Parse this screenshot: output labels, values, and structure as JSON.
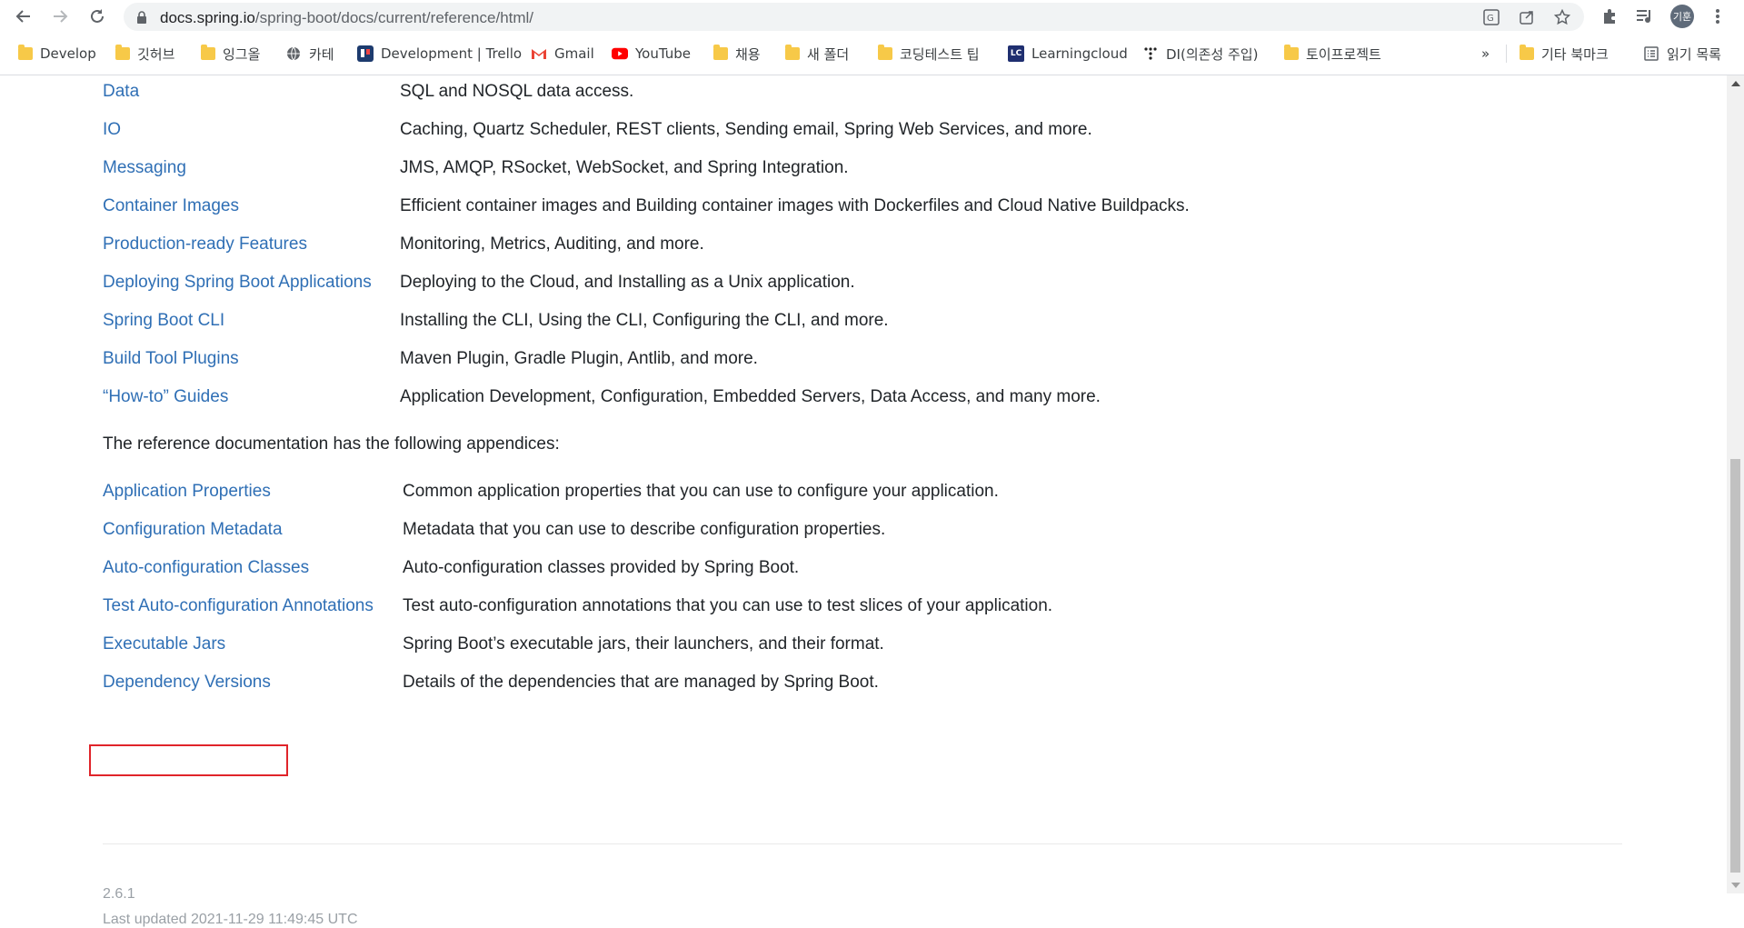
{
  "browser": {
    "url_host": "docs.spring.io",
    "url_path": "/spring-boot/docs/current/reference/html/",
    "avatar_text": "기훈"
  },
  "bookmarks": [
    {
      "label": "Develop",
      "icon": "folder-icon"
    },
    {
      "label": "깃허브",
      "icon": "folder-icon"
    },
    {
      "label": "잉그올",
      "icon": "folder-icon"
    },
    {
      "label": "카테",
      "icon": "globe-icon"
    },
    {
      "label": "Development | Trello",
      "icon": "trello-icon"
    },
    {
      "label": "Gmail",
      "icon": "gmail-icon"
    },
    {
      "label": "YouTube",
      "icon": "youtube-icon"
    },
    {
      "label": "채용",
      "icon": "folder-icon"
    },
    {
      "label": "새 폴더",
      "icon": "folder-icon"
    },
    {
      "label": "코딩테스트 팁",
      "icon": "folder-icon"
    },
    {
      "label": "Learningcloud",
      "icon": "lc-icon"
    },
    {
      "label": "DI(의존성 주입)",
      "icon": "dots-icon"
    },
    {
      "label": "토이프로젝트",
      "icon": "folder-icon"
    }
  ],
  "bookmarks_overflow": "»",
  "other_bookmarks": "기타 북마크",
  "reading_list": "읽기 목록",
  "sections": [
    {
      "link": "Data",
      "desc": "SQL and NOSQL data access."
    },
    {
      "link": "IO",
      "desc": "Caching, Quartz Scheduler, REST clients, Sending email, Spring Web Services, and more."
    },
    {
      "link": "Messaging",
      "desc": "JMS, AMQP, RSocket, WebSocket, and Spring Integration."
    },
    {
      "link": "Container Images",
      "desc": "Efficient container images and Building container images with Dockerfiles and Cloud Native Buildpacks."
    },
    {
      "link": "Production-ready Features",
      "desc": "Monitoring, Metrics, Auditing, and more."
    },
    {
      "link": "Deploying Spring Boot Applications",
      "desc": "Deploying to the Cloud, and Installing as a Unix application."
    },
    {
      "link": "Spring Boot CLI",
      "desc": "Installing the CLI, Using the CLI, Configuring the CLI, and more."
    },
    {
      "link": "Build Tool Plugins",
      "desc": "Maven Plugin, Gradle Plugin, Antlib, and more."
    },
    {
      "link": "“How-to” Guides",
      "desc": "Application Development, Configuration, Embedded Servers, Data Access, and many more."
    }
  ],
  "appendices_intro": "The reference documentation has the following appendices:",
  "appendices": [
    {
      "link": "Application Properties",
      "desc": "Common application properties that you can use to configure your application."
    },
    {
      "link": "Configuration Metadata",
      "desc": "Metadata that you can use to describe configuration properties."
    },
    {
      "link": "Auto-configuration Classes",
      "desc": "Auto-configuration classes provided by Spring Boot."
    },
    {
      "link": "Test Auto-configuration Annotations",
      "desc": "Test auto-configuration annotations that you can use to test slices of your application."
    },
    {
      "link": "Executable Jars",
      "desc": "Spring Boot’s executable jars, their launchers, and their format."
    },
    {
      "link": "Dependency Versions",
      "desc": "Details of the dependencies that are managed by Spring Boot."
    }
  ],
  "footer": {
    "version": "2.6.1",
    "last_updated": "Last updated 2021-11-29 11:49:45 UTC"
  },
  "colors": {
    "link": "#2f6fb5",
    "text": "#212529",
    "highlight": "#e0242a"
  }
}
